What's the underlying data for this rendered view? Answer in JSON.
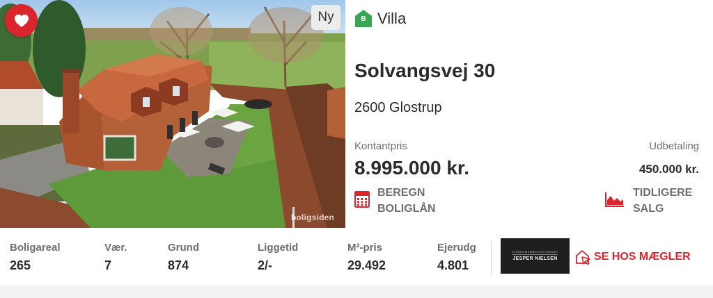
{
  "listing": {
    "badge_new": "Ny",
    "energy_label": "B",
    "property_type": "Villa",
    "address": "Solvangsvej 30",
    "city": "2600 Glostrup",
    "price_label": "Kontantpris",
    "price": "8.995.000 kr.",
    "down_payment_label": "Udbetaling",
    "down_payment": "450.000 kr.",
    "loan_line1": "BEREGN",
    "loan_line2": "BOLIGLÅN",
    "history_line1": "TIDLIGERE",
    "history_line2": "SALG",
    "watermark": "boligsiden"
  },
  "stats": [
    {
      "label": "Boligareal",
      "value": "265"
    },
    {
      "label": "Vær.",
      "value": "7"
    },
    {
      "label": "Grund",
      "value": "874"
    },
    {
      "label": "Liggetid",
      "value": "2/-"
    },
    {
      "label": "M²-pris",
      "value": "29.492"
    },
    {
      "label": "Ejerudg",
      "value": "4.801"
    }
  ],
  "agent": {
    "logo_small": "EJENDOMSMÆGLERFIRMAET",
    "logo_name": "JESPER NIELSEN",
    "link_label": "SE HOS MÆGLER"
  },
  "icons": {
    "favorite": "heart-icon",
    "energy": "house-badge-icon",
    "loan": "calculator-icon",
    "history": "area-chart-icon",
    "agent": "house-pointer-icon"
  },
  "colors": {
    "accent": "#d9252b",
    "energy_b": "#3aa655",
    "text": "#2b2b2b",
    "muted": "#6f6f6f"
  }
}
